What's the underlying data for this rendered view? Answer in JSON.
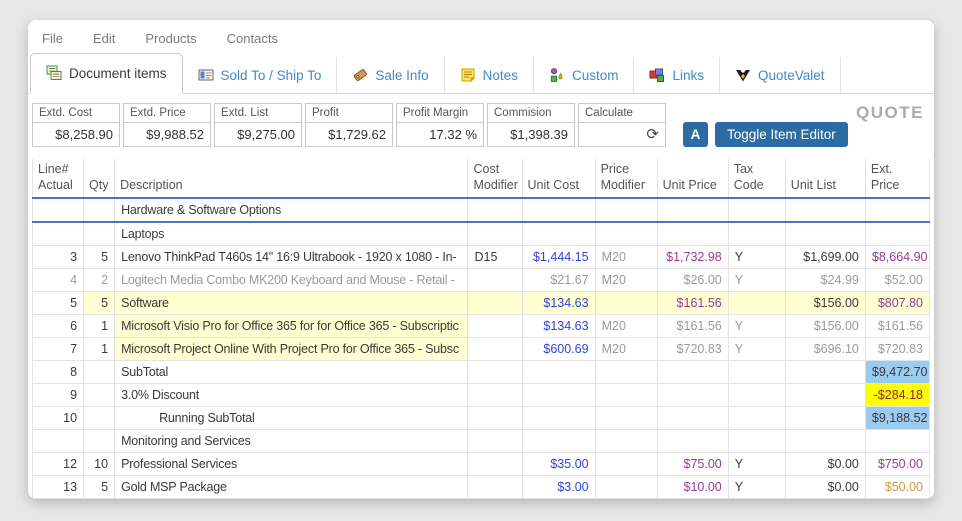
{
  "palette": {
    "accent_blue": "#4579c2",
    "button_blue": "#2d6ca2",
    "tab_link_blue": "#4289c7",
    "blue": "#3142d6",
    "purple": "#9a3a9a",
    "gray": "#9a9a9e",
    "red": "#a02236",
    "orange": "#cf9b3a",
    "pale": "#ffffd2",
    "bright": "#ffff00",
    "lightblue": "#9ccbf0"
  },
  "menu": {
    "items": [
      "File",
      "Edit",
      "Products",
      "Contacts"
    ]
  },
  "tabs": [
    {
      "label": "Document items",
      "icon": "document-items-icon",
      "active": true
    },
    {
      "label": "Sold To / Ship To",
      "icon": "address-card-icon",
      "active": false
    },
    {
      "label": "Sale Info",
      "icon": "price-tag-icon",
      "active": false
    },
    {
      "label": "Notes",
      "icon": "sticky-note-icon",
      "active": false
    },
    {
      "label": "Custom",
      "icon": "custom-fields-icon",
      "active": false
    },
    {
      "label": "Links",
      "icon": "links-icon",
      "active": false
    },
    {
      "label": "QuoteValet",
      "icon": "quotevalet-icon",
      "active": false
    }
  ],
  "summary": {
    "boxes": [
      {
        "label": "Extd. Cost",
        "value": "$8,258.90"
      },
      {
        "label": "Extd. Price",
        "value": "$9,988.52"
      },
      {
        "label": "Extd. List",
        "value": "$9,275.00"
      },
      {
        "label": "Profit",
        "value": "$1,729.62"
      },
      {
        "label": "Profit Margin",
        "value": "17.32 %"
      },
      {
        "label": "Commision",
        "value": "$1,398.39"
      },
      {
        "label": "Calculate",
        "value": "",
        "icon": "refresh-icon",
        "glyph": "⟳"
      }
    ],
    "a_button_label": "A",
    "toggle_button_label": "Toggle Item Editor",
    "doc_type_label": "QUOTE"
  },
  "table": {
    "columns": [
      {
        "key": "line",
        "line1": "Line#",
        "line2": "Actual"
      },
      {
        "key": "qty",
        "line1": "",
        "line2": "Qty"
      },
      {
        "key": "desc",
        "line1": "",
        "line2": "Description"
      },
      {
        "key": "cost_mod",
        "line1": "Cost",
        "line2": "Modifier"
      },
      {
        "key": "unit_cost",
        "line1": "",
        "line2": "Unit Cost"
      },
      {
        "key": "price_mod",
        "line1": "Price",
        "line2": "Modifier"
      },
      {
        "key": "unit_price",
        "line1": "",
        "line2": "Unit Price"
      },
      {
        "key": "tax",
        "line1": "",
        "line2": "Tax Code"
      },
      {
        "key": "unit_list",
        "line1": "",
        "line2": "Unit List"
      },
      {
        "key": "ext_price",
        "line1": "",
        "line2": "Ext. Price"
      }
    ],
    "rows": [
      {
        "line": "",
        "qty": "",
        "desc": "Hardware & Software Options",
        "selected": true
      },
      {
        "line": "",
        "qty": "",
        "desc": "Laptops"
      },
      {
        "line": "3",
        "qty": "5",
        "desc": "Lenovo ThinkPad T460s 14\" 16:9 Ultrabook - 1920 x 1080 - In-",
        "cost_mod": "D15",
        "unit_cost": "$1,444.15",
        "price_mod": "M20",
        "unit_price": "$1,732.98",
        "tax": "Y",
        "unit_list": "$1,699.00",
        "ext_price": "$8,664.90",
        "cell_colors": {
          "unit_cost": "blue",
          "price_mod": "gray",
          "unit_price": "purple",
          "ext_price": "purple"
        }
      },
      {
        "line": "4",
        "qty": "2",
        "desc": "Logitech Media Combo MK200 Keyboard and Mouse - Retail -",
        "unit_cost": "$21.67",
        "price_mod": "M20",
        "unit_price": "$26.00",
        "tax": "Y",
        "unit_list": "$24.99",
        "ext_price": "$52.00",
        "muted": true
      },
      {
        "line": "5",
        "qty": "5",
        "desc": "Software",
        "unit_cost": "$134.63",
        "unit_price": "$161.56",
        "unit_list": "$156.00",
        "ext_price": "$807.80",
        "cell_colors": {
          "unit_cost": "blue",
          "unit_price": "purple",
          "ext_price": "purple"
        },
        "cell_bgs": {
          "qty": "pale",
          "desc": "pale",
          "cost_mod": "pale",
          "unit_cost": "pale",
          "price_mod": "pale",
          "unit_price": "pale",
          "tax": "pale",
          "unit_list": "pale",
          "ext_price": "pale"
        }
      },
      {
        "line": "6",
        "qty": "1",
        "desc": "Microsoft Visio Pro for Office 365 for for Office 365 - Subscriptic",
        "unit_cost": "$134.63",
        "price_mod": "M20",
        "unit_price": "$161.56",
        "tax": "Y",
        "unit_list": "$156.00",
        "ext_price": "$161.56",
        "cell_colors": {
          "unit_cost": "blue",
          "price_mod": "gray",
          "unit_price": "gray",
          "tax": "gray",
          "unit_list": "gray",
          "ext_price": "gray"
        },
        "cell_bgs": {
          "desc": "pale"
        }
      },
      {
        "line": "7",
        "qty": "1",
        "desc": "Microsoft Project Online With Project Pro for Office 365 - Subsc",
        "unit_cost": "$600.69",
        "price_mod": "M20",
        "unit_price": "$720.83",
        "tax": "Y",
        "unit_list": "$696.10",
        "ext_price": "$720.83",
        "cell_colors": {
          "unit_cost": "blue",
          "price_mod": "gray",
          "unit_price": "gray",
          "tax": "gray",
          "unit_list": "gray",
          "ext_price": "gray"
        },
        "cell_bgs": {
          "desc": "pale"
        }
      },
      {
        "line": "8",
        "qty": "",
        "desc": "SubTotal",
        "ext_price": "$9,472.70",
        "cell_bgs": {
          "ext_price": "lightblue"
        }
      },
      {
        "line": "9",
        "qty": "",
        "desc": "3.0% Discount",
        "ext_price": "-$284.18",
        "cell_colors": {
          "ext_price": "red"
        },
        "cell_bgs": {
          "ext_price": "bright"
        }
      },
      {
        "line": "10",
        "qty": "",
        "desc": "Running SubTotal",
        "ext_price": "$9,188.52",
        "indent": true,
        "cell_bgs": {
          "ext_price": "lightblue"
        }
      },
      {
        "line": "",
        "qty": "",
        "desc": "Monitoring and Services"
      },
      {
        "line": "12",
        "qty": "10",
        "desc": "Professional Services",
        "unit_cost": "$35.00",
        "unit_price": "$75.00",
        "tax": "Y",
        "unit_list": "$0.00",
        "ext_price": "$750.00",
        "cell_colors": {
          "unit_cost": "blue",
          "unit_price": "purple",
          "ext_price": "purple"
        }
      },
      {
        "line": "13",
        "qty": "5",
        "desc": "Gold MSP Package",
        "unit_cost": "$3.00",
        "unit_price": "$10.00",
        "tax": "Y",
        "unit_list": "$0.00",
        "ext_price": "$50.00",
        "cell_colors": {
          "unit_cost": "blue",
          "unit_price": "purple",
          "ext_price": "orange"
        }
      }
    ]
  }
}
